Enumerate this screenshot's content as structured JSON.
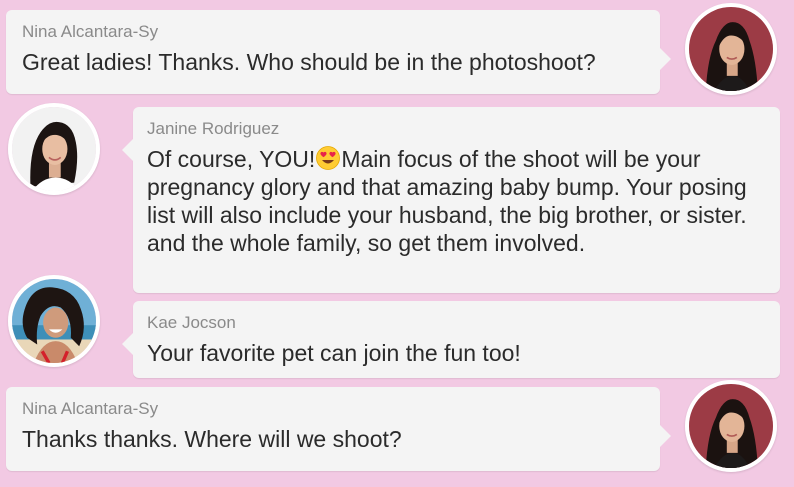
{
  "messages": [
    {
      "sender": "Nina Alcantara-Sy",
      "text": "Great ladies! Thanks. Who should be in the photoshoot?"
    },
    {
      "sender": "Janine Rodriguez",
      "text_before": "Of course, YOU!",
      "emoji": "heart-eyes-emoji",
      "text_after": "Main focus of the shoot will be your pregnancy glory and that amazing baby bump. Your posing list will also include your husband, the big brother, or sister.  and the whole family, so get them involved."
    },
    {
      "sender": "Kae Jocson",
      "text": "Your favorite pet can join the fun too!"
    },
    {
      "sender": "Nina Alcantara-Sy",
      "text": "Thanks thanks. Where will we shoot?"
    }
  ],
  "colors": {
    "background": "#f2c9e3",
    "bubble": "#f4f4f4",
    "sender_text": "#8a8a8a",
    "message_text": "#2b2b2b"
  }
}
